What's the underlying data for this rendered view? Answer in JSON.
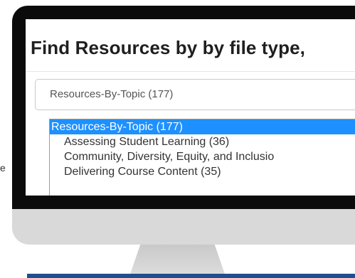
{
  "page": {
    "heading": "Find Resources by by file type,",
    "edge_fragment": "e"
  },
  "select": {
    "value": "Resources-By-Topic  (177)"
  },
  "dropdown": {
    "options": [
      {
        "label": "Resources-By-Topic  (177)",
        "selected": true
      },
      {
        "label": "Assessing Student Learning  (36)",
        "selected": false
      },
      {
        "label": "Community, Diversity, Equity, and Inclusio",
        "selected": false
      },
      {
        "label": "Delivering Course Content  (35)",
        "selected": false
      }
    ]
  },
  "colors": {
    "selection": "#1e90ff",
    "bezel": "#0b0b0b",
    "chin": "#d9d9d9",
    "base_line": "#1f4f8f"
  }
}
